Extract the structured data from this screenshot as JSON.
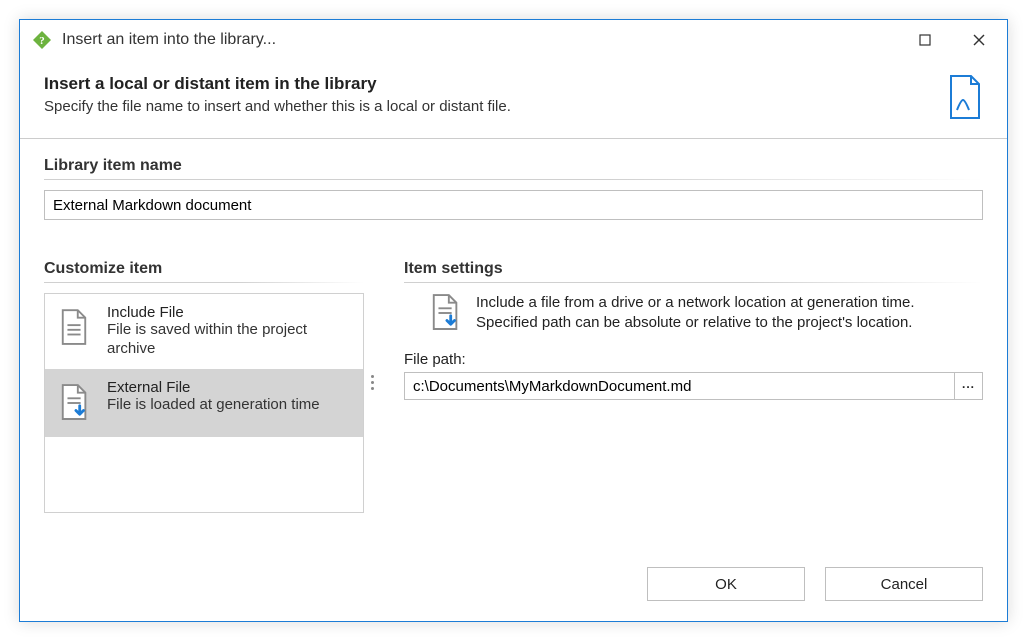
{
  "window": {
    "title": "Insert an item into the library..."
  },
  "header": {
    "title": "Insert a local or distant item in the library",
    "subtitle": "Specify the file name to insert and whether this is a local or distant file."
  },
  "nameSection": {
    "label": "Library item name",
    "value": "External Markdown document"
  },
  "customize": {
    "label": "Customize item",
    "items": [
      {
        "title": "Include File",
        "desc": "File is saved within the project archive"
      },
      {
        "title": "External File",
        "desc": "File is loaded at generation time"
      }
    ],
    "selectedIndex": 1
  },
  "settings": {
    "label": "Item settings",
    "infoLine1": "Include a file from a drive or a network location at generation time.",
    "infoLine2": "Specified path can be absolute or relative to the project's location.",
    "filePathLabel": "File path:",
    "filePathValue": "c:\\Documents\\MyMarkdownDocument.md",
    "browseLabel": "..."
  },
  "buttons": {
    "ok": "OK",
    "cancel": "Cancel"
  }
}
